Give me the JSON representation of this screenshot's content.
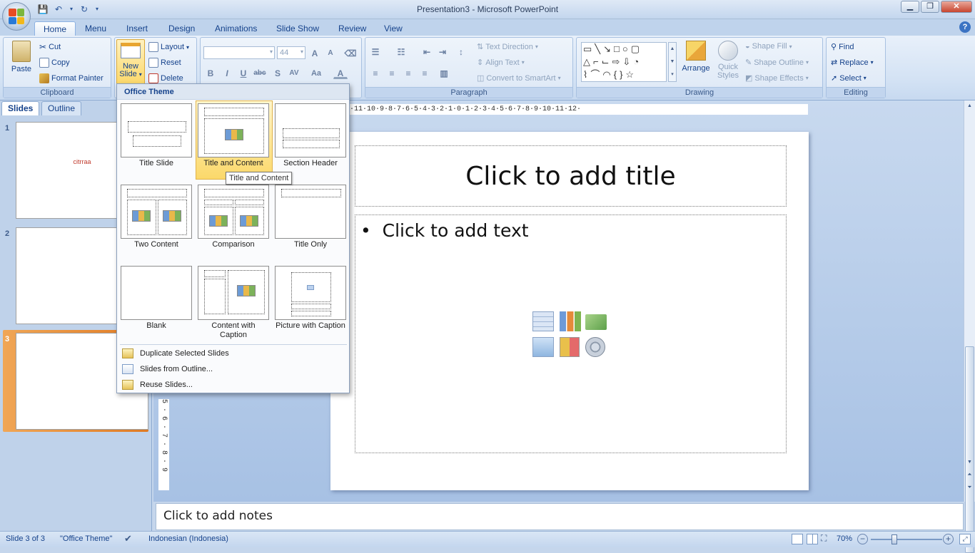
{
  "window": {
    "title": "Presentation3 - Microsoft PowerPoint",
    "minimize": "▁",
    "maximize": "❐",
    "close": "✕"
  },
  "ribbon_tabs": [
    "Home",
    "Menu",
    "Insert",
    "Design",
    "Animations",
    "Slide Show",
    "Review",
    "View"
  ],
  "help": "?",
  "clipboard": {
    "paste": "Paste",
    "cut": "Cut",
    "copy": "Copy",
    "format_painter": "Format Painter",
    "label": "Clipboard"
  },
  "slides_group": {
    "new_slide_line1": "New",
    "new_slide_line2": "Slide",
    "layout": "Layout",
    "reset": "Reset",
    "delete": "Delete"
  },
  "font": {
    "size": "44",
    "name": ""
  },
  "paragraph": {
    "text_direction": "Text Direction",
    "align_text": "Align Text",
    "convert_smartart": "Convert to SmartArt",
    "label": "Paragraph"
  },
  "drawing": {
    "arrange": "Arrange",
    "quick_styles_line1": "Quick",
    "quick_styles_line2": "Styles",
    "shape_fill": "Shape Fill",
    "shape_outline": "Shape Outline",
    "shape_effects": "Shape Effects",
    "label": "Drawing"
  },
  "editing": {
    "find": "Find",
    "replace": "Replace",
    "select": "Select",
    "label": "Editing"
  },
  "panel_tabs": {
    "slides": "Slides",
    "outline": "Outline"
  },
  "thumbnails": [
    {
      "number": "1",
      "text": "citrraa"
    },
    {
      "number": "2",
      "text": ""
    },
    {
      "number": "3",
      "text": ""
    }
  ],
  "layout_menu": {
    "header": "Office Theme",
    "layouts": [
      "Title Slide",
      "Title and Content",
      "Section Header",
      "Two Content",
      "Comparison",
      "Title Only",
      "Blank",
      "Content with Caption",
      "Picture with Caption"
    ],
    "tooltip": "Title and Content",
    "actions": [
      "Duplicate Selected Slides",
      "Slides from Outline...",
      "Reuse Slides..."
    ]
  },
  "ruler_text": "·11·10·9·8·7·6·5·4·3·2·1·0·1·2·3·4·5·6·7·8·9·10·11·12·",
  "vruler_text": "5 · 6 · 7 · 8 · 9",
  "slide": {
    "title_placeholder": "Click to add title",
    "content_placeholder": "Click to add text",
    "bullet": "•"
  },
  "notes_placeholder": "Click to add notes",
  "status": {
    "slide": "Slide 3 of 3",
    "theme": "\"Office Theme\"",
    "language": "Indonesian (Indonesia)",
    "zoom": "70%"
  },
  "colors": {
    "accent": "#15428b",
    "ribbon_bg": "#dde8f6",
    "selected_thumb": "#e8892e",
    "highlight": "#fbd86a"
  }
}
